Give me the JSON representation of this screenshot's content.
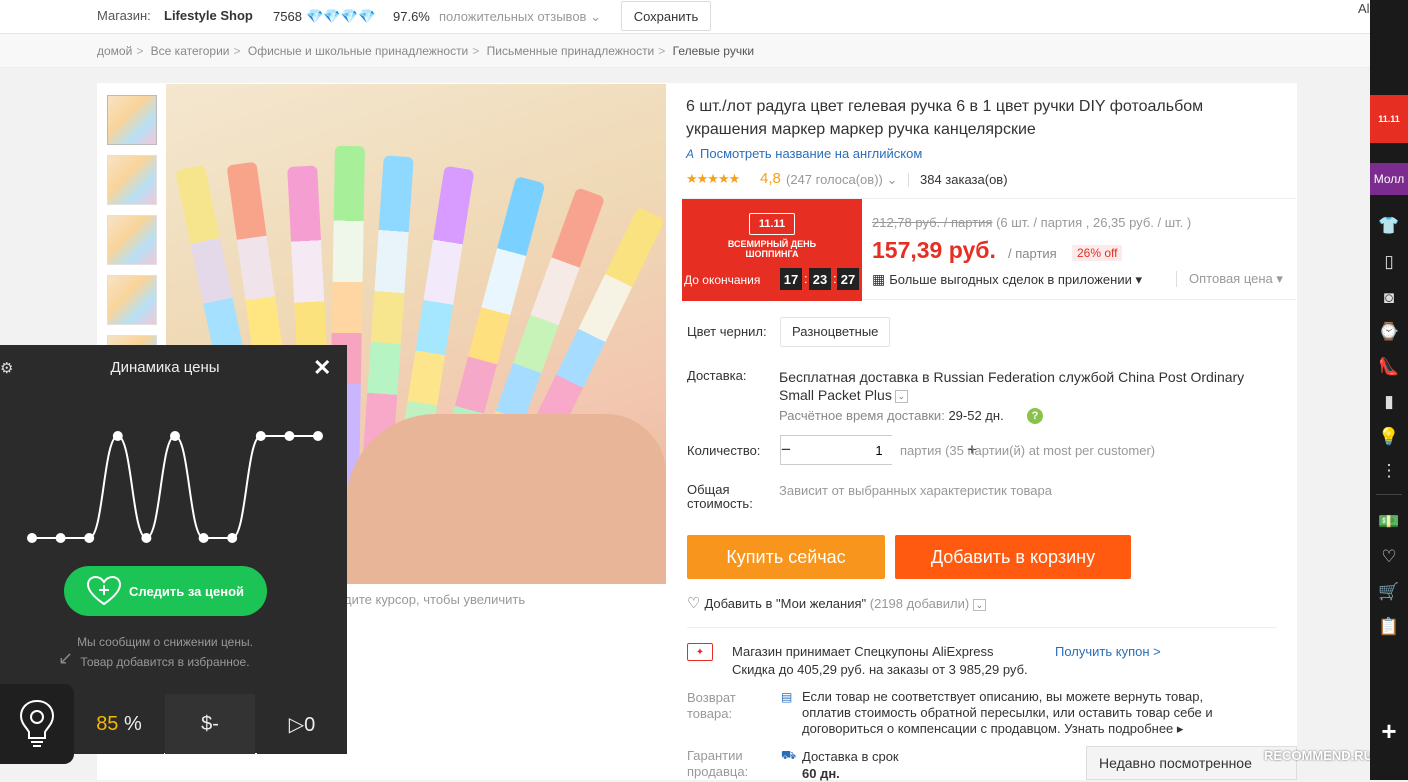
{
  "header": {
    "store_label": "Магазин:",
    "store_name": "Lifestyle Shop",
    "store_rating": "7568",
    "diamonds": "💎💎💎💎",
    "feedback_pct": "97.6%",
    "feedback_text": "положительных отзывов",
    "save_label": "Сохранить",
    "brand_watermark": "Alis.sa"
  },
  "breadcrumbs": [
    "домой",
    "Все категории",
    "Офисные и школьные принадлежности",
    "Письменные принадлежности",
    "Гелевые ручки"
  ],
  "product": {
    "title": "6 шт./лот радуга цвет гелевая ручка 6 в 1 цвет ручки DIY фотоальбом украшения маркер маркер ручка канцелярские",
    "translate_icon": "A",
    "translate_label": "Посмотреть название на английском",
    "stars": "★★★★★",
    "rating": "4,8",
    "votes": "(247 голоса(ов))",
    "orders": "384 заказа(ов)",
    "zoom_hint": "дите курсор, чтобы увеличить"
  },
  "promo": {
    "logo": "11.11",
    "line1": "ВСЕМИРНЫЙ ДЕНЬ",
    "line2": "ШОППИНГА",
    "until": "До окончания",
    "hh": "17",
    "mm": "23",
    "ss": "27"
  },
  "price": {
    "old": "212,78 руб. / партия",
    "old_note": "(6 шт. / партия , 26,35 руб. / шт. )",
    "new": "157,39 руб.",
    "per_lot": "/ партия",
    "discount": "26% off",
    "app_deals": "Больше выгодных сделок в приложении ▾",
    "wholesale": "Оптовая цена ▾"
  },
  "options": {
    "ink_label": "Цвет чернил:",
    "ink_value": "Разноцветные",
    "ship_label": "Доставка:",
    "ship_text": "Бесплатная доставка в Russian Federation службой China Post Ordinary Small Packet Plus",
    "eta_label": "Расчётное время доставки:",
    "eta_value": "29-52 дн.",
    "qty_label": "Количество:",
    "qty_value": "1",
    "qty_note": "партия (35 партии(й) at most per customer)",
    "total_label": "Общая стоимость:",
    "total_value": "Зависит от выбранных характеристик товара"
  },
  "actions": {
    "buy": "Купить сейчас",
    "cart": "Добавить в корзину",
    "wish": "Добавить в \"Мои желания\"",
    "wish_count": "(2198 добавили)"
  },
  "coupon": {
    "title": "Магазин принимает Спецкупоны AliExpress",
    "sub": "Скидка до 405,29 руб. на заказы от 3 985,29 руб.",
    "link": "Получить купон >"
  },
  "returns": {
    "label": "Возврат товара:",
    "text": "Если товар не соответствует описанию, вы можете вернуть товар, оплатив стоимость обратной пересылки, или оставить товар себе и договориться о компенсации с продавцом.",
    "more": "Узнать подробнее ▸"
  },
  "guarantee": {
    "label": "Гарантии продавца:",
    "line1": "Доставка в срок",
    "line2": "60 дн."
  },
  "recent": "Недавно посмотренное",
  "watermark": "RECOMMEND.RU",
  "sidebar": {
    "promo": "11.11",
    "mall": "Молл"
  },
  "widget": {
    "title": "Динамика цены",
    "track": "Следить за ценой",
    "note1": "Мы сообщим о снижении цены.",
    "note2": "Товар добавится в избранное.",
    "score": "85",
    "score_unit": "%",
    "dollar": "$-",
    "views": "▷0",
    "chart_points": [
      2,
      2,
      2,
      12,
      2,
      12,
      2,
      2,
      12,
      12,
      12
    ]
  },
  "colors": {
    "accent_red": "#e62e22",
    "buy_orange": "#f8951d",
    "cart_orange": "#ff5a0f",
    "link_blue": "#2a6ebb",
    "track_green": "#1cc355"
  }
}
